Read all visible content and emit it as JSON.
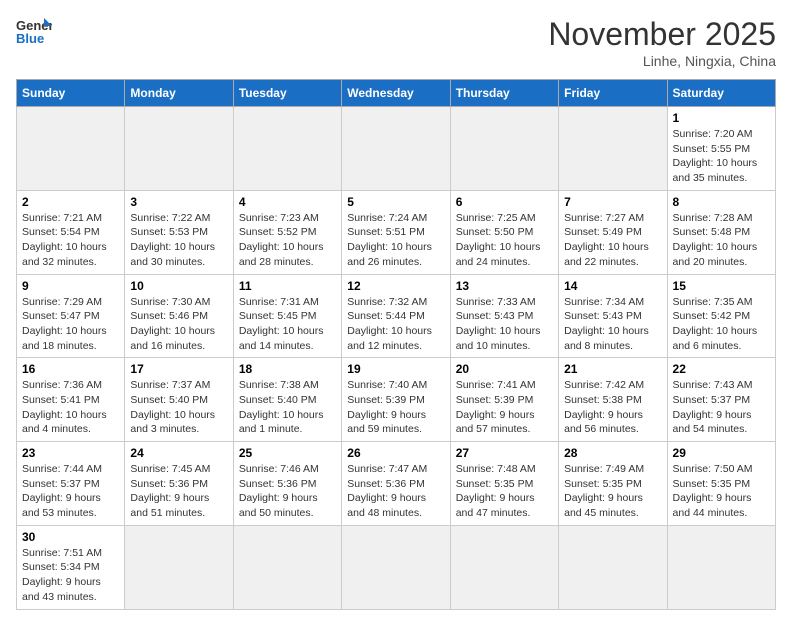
{
  "header": {
    "logo_general": "General",
    "logo_blue": "Blue",
    "month_title": "November 2025",
    "location": "Linhe, Ningxia, China"
  },
  "days_of_week": [
    "Sunday",
    "Monday",
    "Tuesday",
    "Wednesday",
    "Thursday",
    "Friday",
    "Saturday"
  ],
  "weeks": [
    [
      {
        "day": "",
        "info": "",
        "empty": true
      },
      {
        "day": "",
        "info": "",
        "empty": true
      },
      {
        "day": "",
        "info": "",
        "empty": true
      },
      {
        "day": "",
        "info": "",
        "empty": true
      },
      {
        "day": "",
        "info": "",
        "empty": true
      },
      {
        "day": "",
        "info": "",
        "empty": true
      },
      {
        "day": "1",
        "info": "Sunrise: 7:20 AM\nSunset: 5:55 PM\nDaylight: 10 hours and 35 minutes."
      }
    ],
    [
      {
        "day": "2",
        "info": "Sunrise: 7:21 AM\nSunset: 5:54 PM\nDaylight: 10 hours and 32 minutes."
      },
      {
        "day": "3",
        "info": "Sunrise: 7:22 AM\nSunset: 5:53 PM\nDaylight: 10 hours and 30 minutes."
      },
      {
        "day": "4",
        "info": "Sunrise: 7:23 AM\nSunset: 5:52 PM\nDaylight: 10 hours and 28 minutes."
      },
      {
        "day": "5",
        "info": "Sunrise: 7:24 AM\nSunset: 5:51 PM\nDaylight: 10 hours and 26 minutes."
      },
      {
        "day": "6",
        "info": "Sunrise: 7:25 AM\nSunset: 5:50 PM\nDaylight: 10 hours and 24 minutes."
      },
      {
        "day": "7",
        "info": "Sunrise: 7:27 AM\nSunset: 5:49 PM\nDaylight: 10 hours and 22 minutes."
      },
      {
        "day": "8",
        "info": "Sunrise: 7:28 AM\nSunset: 5:48 PM\nDaylight: 10 hours and 20 minutes."
      }
    ],
    [
      {
        "day": "9",
        "info": "Sunrise: 7:29 AM\nSunset: 5:47 PM\nDaylight: 10 hours and 18 minutes."
      },
      {
        "day": "10",
        "info": "Sunrise: 7:30 AM\nSunset: 5:46 PM\nDaylight: 10 hours and 16 minutes."
      },
      {
        "day": "11",
        "info": "Sunrise: 7:31 AM\nSunset: 5:45 PM\nDaylight: 10 hours and 14 minutes."
      },
      {
        "day": "12",
        "info": "Sunrise: 7:32 AM\nSunset: 5:44 PM\nDaylight: 10 hours and 12 minutes."
      },
      {
        "day": "13",
        "info": "Sunrise: 7:33 AM\nSunset: 5:43 PM\nDaylight: 10 hours and 10 minutes."
      },
      {
        "day": "14",
        "info": "Sunrise: 7:34 AM\nSunset: 5:43 PM\nDaylight: 10 hours and 8 minutes."
      },
      {
        "day": "15",
        "info": "Sunrise: 7:35 AM\nSunset: 5:42 PM\nDaylight: 10 hours and 6 minutes."
      }
    ],
    [
      {
        "day": "16",
        "info": "Sunrise: 7:36 AM\nSunset: 5:41 PM\nDaylight: 10 hours and 4 minutes."
      },
      {
        "day": "17",
        "info": "Sunrise: 7:37 AM\nSunset: 5:40 PM\nDaylight: 10 hours and 3 minutes."
      },
      {
        "day": "18",
        "info": "Sunrise: 7:38 AM\nSunset: 5:40 PM\nDaylight: 10 hours and 1 minute."
      },
      {
        "day": "19",
        "info": "Sunrise: 7:40 AM\nSunset: 5:39 PM\nDaylight: 9 hours and 59 minutes."
      },
      {
        "day": "20",
        "info": "Sunrise: 7:41 AM\nSunset: 5:39 PM\nDaylight: 9 hours and 57 minutes."
      },
      {
        "day": "21",
        "info": "Sunrise: 7:42 AM\nSunset: 5:38 PM\nDaylight: 9 hours and 56 minutes."
      },
      {
        "day": "22",
        "info": "Sunrise: 7:43 AM\nSunset: 5:37 PM\nDaylight: 9 hours and 54 minutes."
      }
    ],
    [
      {
        "day": "23",
        "info": "Sunrise: 7:44 AM\nSunset: 5:37 PM\nDaylight: 9 hours and 53 minutes."
      },
      {
        "day": "24",
        "info": "Sunrise: 7:45 AM\nSunset: 5:36 PM\nDaylight: 9 hours and 51 minutes."
      },
      {
        "day": "25",
        "info": "Sunrise: 7:46 AM\nSunset: 5:36 PM\nDaylight: 9 hours and 50 minutes."
      },
      {
        "day": "26",
        "info": "Sunrise: 7:47 AM\nSunset: 5:36 PM\nDaylight: 9 hours and 48 minutes."
      },
      {
        "day": "27",
        "info": "Sunrise: 7:48 AM\nSunset: 5:35 PM\nDaylight: 9 hours and 47 minutes."
      },
      {
        "day": "28",
        "info": "Sunrise: 7:49 AM\nSunset: 5:35 PM\nDaylight: 9 hours and 45 minutes."
      },
      {
        "day": "29",
        "info": "Sunrise: 7:50 AM\nSunset: 5:35 PM\nDaylight: 9 hours and 44 minutes."
      }
    ],
    [
      {
        "day": "30",
        "info": "Sunrise: 7:51 AM\nSunset: 5:34 PM\nDaylight: 9 hours and 43 minutes."
      },
      {
        "day": "",
        "info": "",
        "empty": true
      },
      {
        "day": "",
        "info": "",
        "empty": true
      },
      {
        "day": "",
        "info": "",
        "empty": true
      },
      {
        "day": "",
        "info": "",
        "empty": true
      },
      {
        "day": "",
        "info": "",
        "empty": true
      },
      {
        "day": "",
        "info": "",
        "empty": true
      }
    ]
  ]
}
